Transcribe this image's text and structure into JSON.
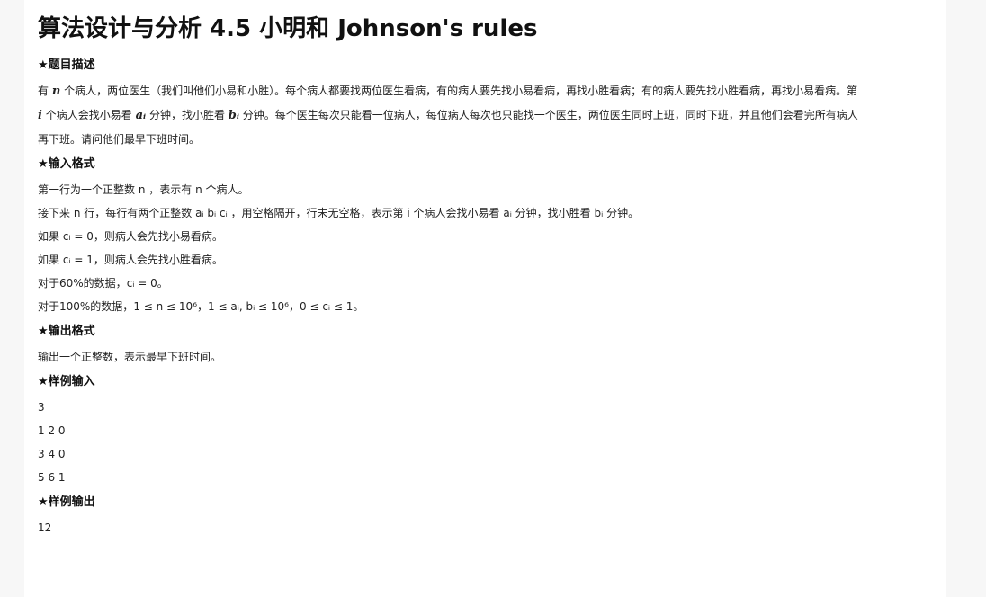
{
  "title": "算法设计与分析 4.5 小明和 Johnson's rules",
  "sections": {
    "description": {
      "heading": "★题目描述",
      "line1_pre": "有 ",
      "line1_n": "n",
      "line1_post": " 个病人，两位医生（我们叫他们小易和小胜）。每个病人都要找两位医生看病，有的病人要先找小易看病，再找小胜看病；有的病人要先找小胜看病，再找小易看病。第",
      "line2_i": "i",
      "line2_a": " 个病人会找小易看 ",
      "line2_ai": "aᵢ",
      "line2_b": " 分钟，找小胜看 ",
      "line2_bi": "bᵢ",
      "line2_c": " 分钟。每个医生每次只能看一位病人，每位病人每次也只能找一个医生，两位医生同时上班，同时下班，并且他们会看完所有病人",
      "line3": "再下班。请问他们最早下班时间。"
    },
    "input_format": {
      "heading": "★输入格式",
      "l1_pre": "第一行为一个正整数 ",
      "l1_n": "n",
      "l1_mid": " ，表示有 ",
      "l1_n2": "n",
      "l1_post": " 个病人。",
      "l2_pre": "接下来 ",
      "l2_n": "n",
      "l2_mid": " 行，每行有两个正整数 ",
      "l2_vars": "aᵢ bᵢ cᵢ",
      "l2_mid2": " ，用空格隔开，行末无空格，表示第 ",
      "l2_i": "i",
      "l2_mid3": " 个病人会找小易看 ",
      "l2_ai": "aᵢ",
      "l2_mid4": " 分钟，找小胜看 ",
      "l2_bi": "bᵢ",
      "l2_post": " 分钟。",
      "l3_pre": "如果 ",
      "l3_eq": "cᵢ = 0",
      "l3_post": "，则病人会先找小易看病。",
      "l4_pre": "如果 ",
      "l4_eq": "cᵢ = 1",
      "l4_post": "，则病人会先找小胜看病。",
      "l5_pre": "对于60%的数据，",
      "l5_eq": "cᵢ = 0",
      "l5_post": "。",
      "l6_pre": "对于100%的数据，",
      "l6_eq1": "1 ≤ n ≤ 10⁶",
      "l6_sep1": "，",
      "l6_eq2": "1 ≤ aᵢ, bᵢ ≤ 10⁶",
      "l6_sep2": "，",
      "l6_eq3": "0 ≤ cᵢ ≤ 1",
      "l6_post": "。"
    },
    "output_format": {
      "heading": "★输出格式",
      "text": "输出一个正整数，表示最早下班时间。"
    },
    "sample_input": {
      "heading": "★样例输入",
      "lines": [
        "3",
        "1 2 0",
        "3 4 0",
        "5 6 1"
      ]
    },
    "sample_output": {
      "heading": "★样例输出",
      "lines": [
        "12"
      ]
    }
  }
}
